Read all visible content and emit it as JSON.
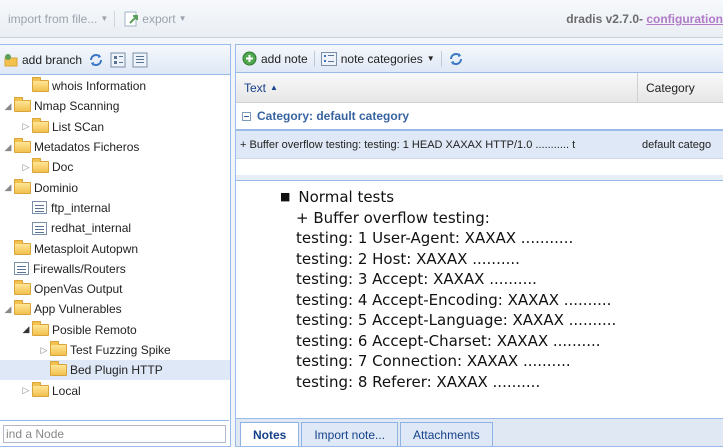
{
  "topbar": {
    "import_label": "import from file...",
    "export_label": "export",
    "brand_text": "dradis v2.7.0- ",
    "brand_link": "configuration"
  },
  "tree": {
    "add_branch_label": "add branch",
    "search_placeholder": "Find a Node",
    "search_value": "ind a Node",
    "nodes": [
      {
        "label": "whois Information",
        "indent": 1,
        "icon": "folder",
        "exp": "",
        "selected": false
      },
      {
        "label": "Nmap Scanning",
        "indent": 0,
        "icon": "folder",
        "exp": "open",
        "selected": false
      },
      {
        "label": "List SCan",
        "indent": 1,
        "icon": "folder",
        "exp": "closed",
        "selected": false
      },
      {
        "label": "Metadatos Ficheros",
        "indent": 0,
        "icon": "folder",
        "exp": "open",
        "selected": false
      },
      {
        "label": "Doc",
        "indent": 1,
        "icon": "folder",
        "exp": "closed",
        "selected": false
      },
      {
        "label": "Dominio",
        "indent": 0,
        "icon": "folder",
        "exp": "open",
        "selected": false
      },
      {
        "label": "ftp_internal",
        "indent": 1,
        "icon": "note",
        "exp": "",
        "selected": false
      },
      {
        "label": "redhat_internal",
        "indent": 1,
        "icon": "note",
        "exp": "",
        "selected": false
      },
      {
        "label": "Metasploit Autopwn",
        "indent": 0,
        "icon": "folder",
        "exp": "",
        "selected": false
      },
      {
        "label": "Firewalls/Routers",
        "indent": 0,
        "icon": "note",
        "exp": "",
        "selected": false
      },
      {
        "label": "OpenVas Output",
        "indent": 0,
        "icon": "folder",
        "exp": "",
        "selected": false
      },
      {
        "label": "App Vulnerables",
        "indent": 0,
        "icon": "folder",
        "exp": "open",
        "selected": false
      },
      {
        "label": "Posible Remoto",
        "indent": 1,
        "icon": "folder",
        "exp": "open-dark",
        "selected": false
      },
      {
        "label": "Test Fuzzing Spike",
        "indent": 2,
        "icon": "folder",
        "exp": "closed",
        "selected": false
      },
      {
        "label": "Bed Plugin HTTP",
        "indent": 2,
        "icon": "folder",
        "exp": "",
        "selected": true
      },
      {
        "label": "Local",
        "indent": 1,
        "icon": "folder",
        "exp": "closed",
        "selected": false
      }
    ]
  },
  "notes": {
    "add_note_label": "add note",
    "categories_label": "note categories",
    "col_text": "Text",
    "col_category": "Category",
    "group_label": "Category: default category",
    "row_text": "+ Buffer overflow testing: testing: 1 HEAD XAXAX HTTP/1.0 ........... t",
    "row_category": "default catego"
  },
  "preview": {
    "heading": "Normal tests",
    "subheading": "+ Buffer overflow testing:",
    "lines": [
      "testing: 1 User-Agent: XAXAX ...........",
      "testing: 2 Host: XAXAX ..........",
      "testing: 3 Accept: XAXAX ..........",
      "testing: 4 Accept-Encoding: XAXAX ..........",
      "testing: 5 Accept-Language: XAXAX ..........",
      "testing: 6 Accept-Charset: XAXAX ..........",
      "testing: 7 Connection: XAXAX ..........",
      "testing: 8 Referer: XAXAX .........."
    ]
  },
  "tabs": [
    "Notes",
    "Import note...",
    "Attachments"
  ],
  "colors": {
    "accent": "#15428b",
    "selection": "#dfe8f6",
    "border": "#99bbe8"
  }
}
